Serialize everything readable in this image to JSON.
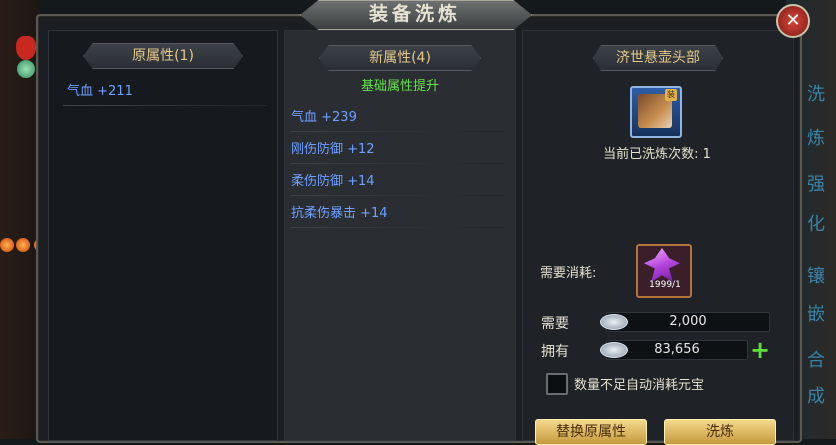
{
  "window": {
    "title": "装备洗炼",
    "close_label": "✕"
  },
  "orig_panel": {
    "header": "原属性(1)",
    "stats": [
      "气血 +211"
    ]
  },
  "new_panel": {
    "header": "新属性(4)",
    "sub_header": "基础属性提升",
    "stats": [
      "气血 +239",
      "刚伤防御 +12",
      "柔伤防御 +14",
      "抗柔伤暴击 +14"
    ]
  },
  "item_panel": {
    "item_name": "济世悬壶头部",
    "item_badge": "装",
    "refine_count_label": "当前已洗炼次数: 1",
    "cost_label": "需要消耗:",
    "material_count": "1999/1",
    "need_label": "需要",
    "need_value": "2,000",
    "have_label": "拥有",
    "have_value": "83,656",
    "auto_consume_label": "数量不足自动消耗元宝",
    "auto_consume_checked": false,
    "btn_left_label": "替换原属性",
    "btn_right_label": "洗炼"
  },
  "side_tabs": [
    "洗",
    "炼",
    "强",
    "化",
    "镶",
    "嵌",
    "合",
    "成"
  ],
  "colors": {
    "stat_blue": "#6fa0ff",
    "sub_header_green": "#66e34a",
    "header_gold": "#e6c98a"
  },
  "icons": [
    "close-icon",
    "equipment-helmet-icon",
    "crystal-material-icon",
    "silver-coin-icon",
    "plus-icon"
  ]
}
